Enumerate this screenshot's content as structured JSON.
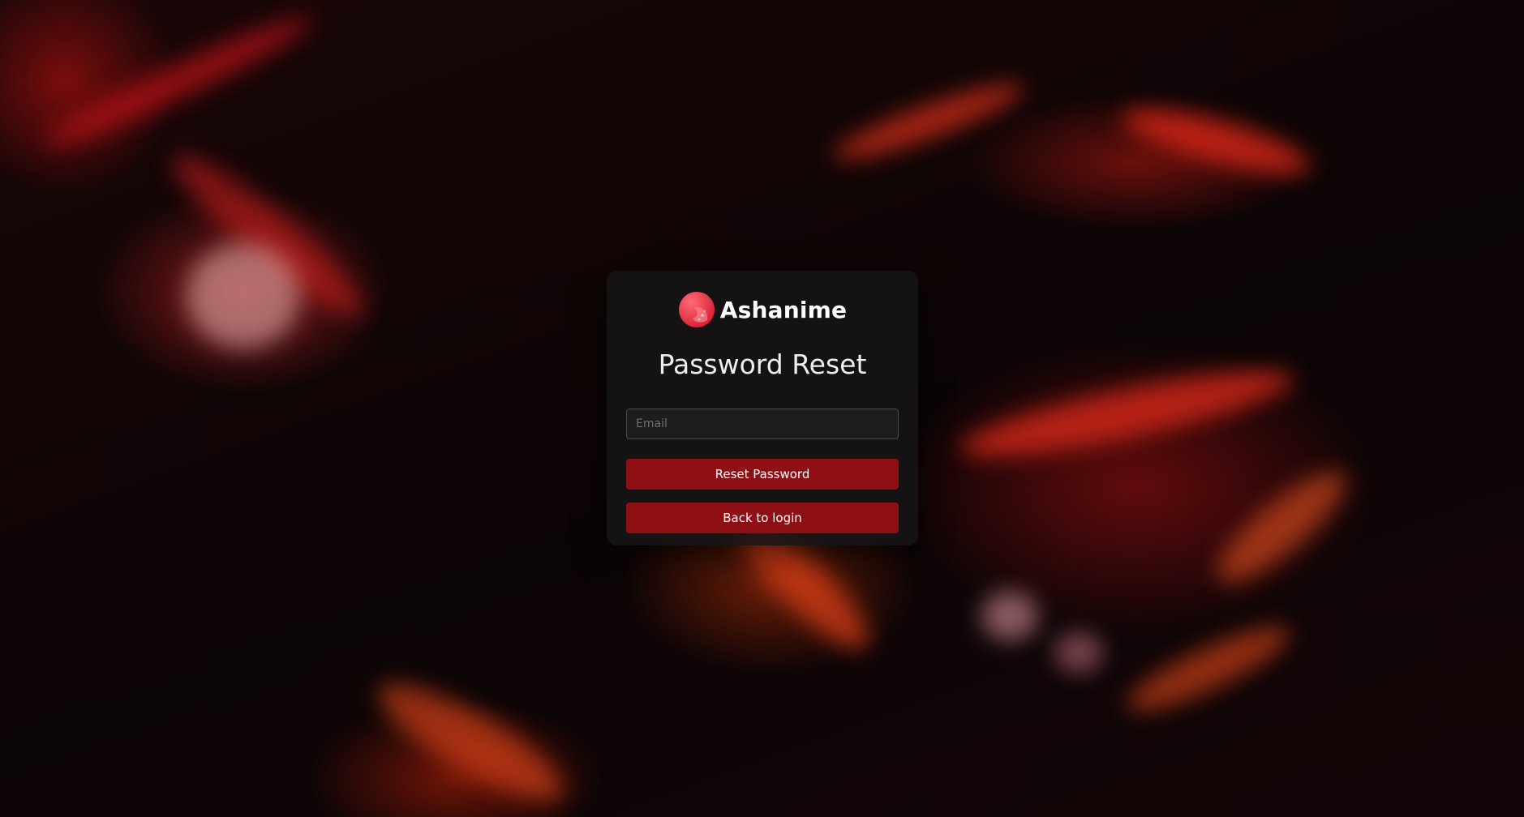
{
  "brand": {
    "name": "Ashanime",
    "logo_icon": "red-planet-icon"
  },
  "form": {
    "title": "Password Reset",
    "email_placeholder": "Email",
    "email_value": "",
    "reset_button_label": "Reset Password",
    "back_button_label": "Back to login"
  },
  "colors": {
    "accent": "#8e1014",
    "card_background": "#161416",
    "logo_red": "#e8334a"
  }
}
